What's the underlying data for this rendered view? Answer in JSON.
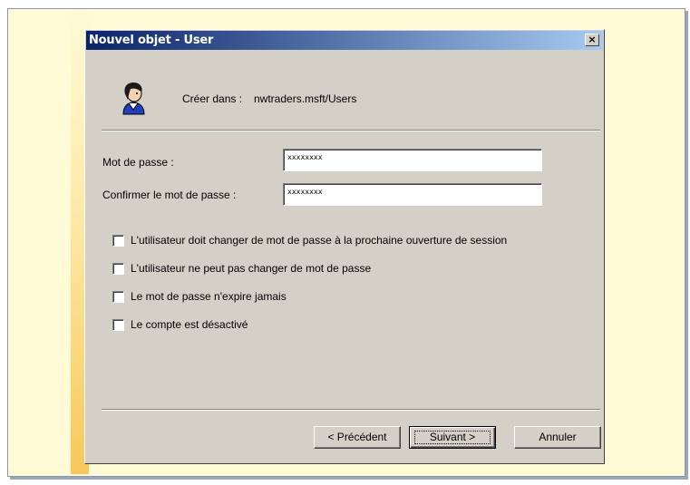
{
  "dialog": {
    "title": "Nouvel objet - User",
    "close_glyph": "×",
    "create_in_label": "Créer dans :",
    "create_in_path": "nwtraders.msft/Users",
    "icon": "user-icon"
  },
  "fields": {
    "password_label": "Mot de passe :",
    "password_value": "xxxxxxxx",
    "confirm_label": "Confirmer le mot de passe :",
    "confirm_value": "xxxxxxxx"
  },
  "options": [
    {
      "label": "L'utilisateur doit changer de mot de passe à la prochaine ouverture de session",
      "checked": false
    },
    {
      "label": "L'utilisateur ne peut pas changer de mot de passe",
      "checked": false
    },
    {
      "label": "Le mot de passe n'expire jamais",
      "checked": false
    },
    {
      "label": "Le compte est désactivé",
      "checked": false
    }
  ],
  "buttons": {
    "back": "< Précédent",
    "next": "Suivant >",
    "cancel": "Annuler"
  },
  "colors": {
    "title_bar_start": "#0a246a",
    "title_bar_end": "#a6caf0",
    "dialog_face": "#d4d0c8",
    "slide_background": "#fffbd6"
  }
}
